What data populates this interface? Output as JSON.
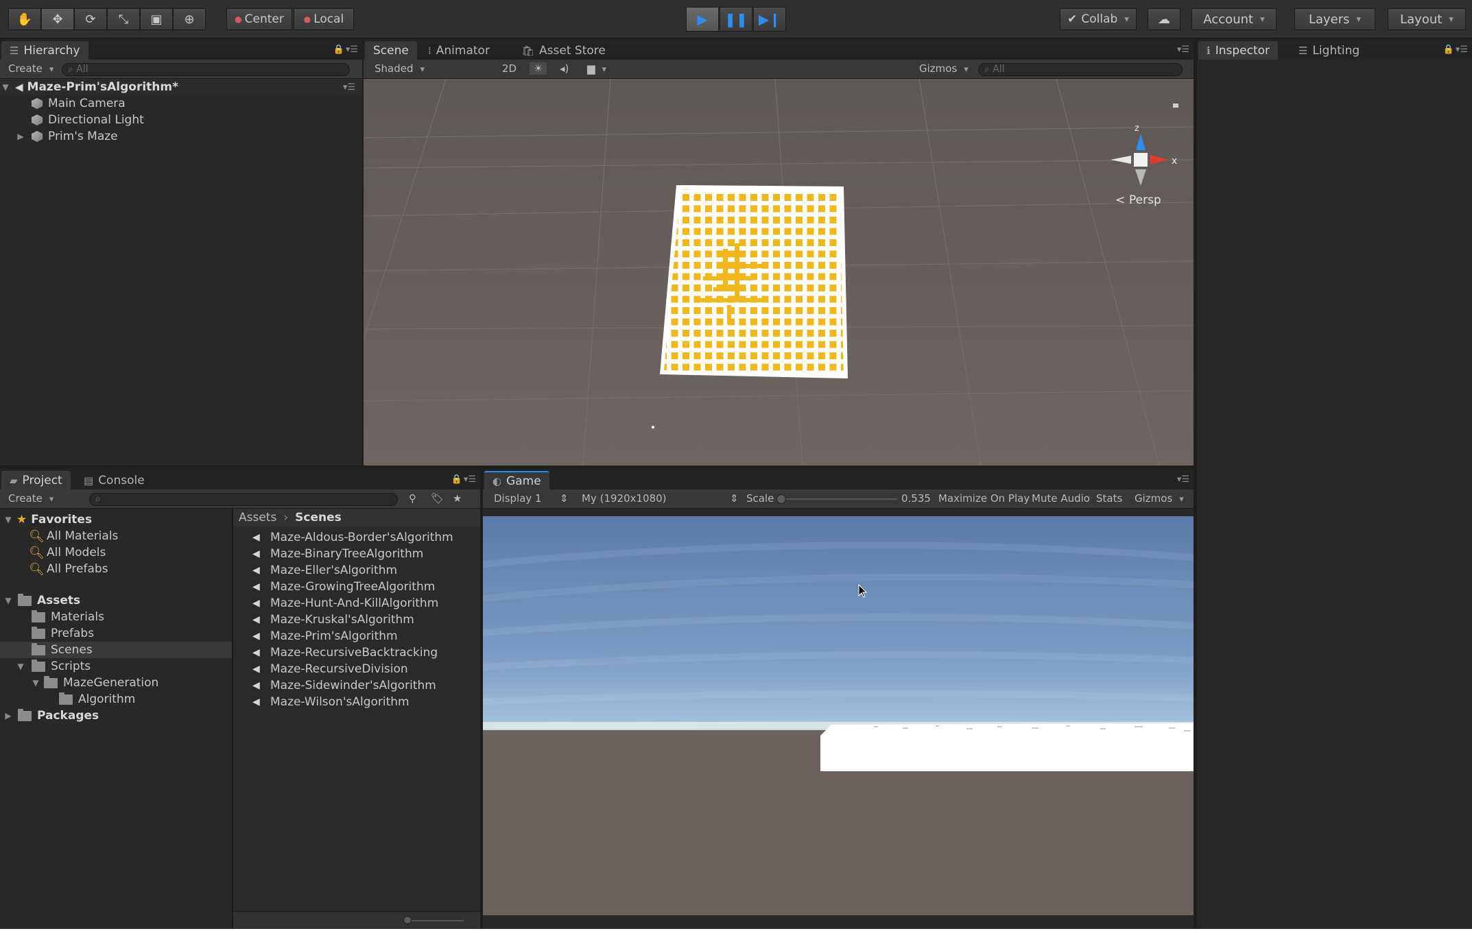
{
  "toolbar": {
    "tools": [
      {
        "icon": "hand-icon",
        "glyph": "✋"
      },
      {
        "icon": "move-icon",
        "glyph": "✥"
      },
      {
        "icon": "rotate-icon",
        "glyph": "⟳"
      },
      {
        "icon": "scale-icon",
        "glyph": "⤡"
      },
      {
        "icon": "rect-icon",
        "glyph": "▣"
      },
      {
        "icon": "transform-icon",
        "glyph": "⊕"
      }
    ],
    "pivot": "Center",
    "space": "Local",
    "collab": "Collab",
    "account": "Account",
    "layers": "Layers",
    "layout": "Layout",
    "accent": "#2f8cf0"
  },
  "hierarchy": {
    "tab": "Hierarchy",
    "create": "Create",
    "search_placeholder": "All",
    "scene_name": "Maze-Prim'sAlgorithm*",
    "items": [
      "Main Camera",
      "Directional Light",
      "Prim's Maze"
    ]
  },
  "scene": {
    "tabs": [
      "Scene",
      "Animator",
      "Asset Store"
    ],
    "shading": "Shaded",
    "mode_2d": "2D",
    "gizmos": "Gizmos",
    "search_placeholder": "All",
    "projection": "Persp",
    "axis_labels": {
      "z": "z",
      "x": "x"
    },
    "maze_color": "#f0b81c"
  },
  "inspector": {
    "tabs": [
      "Inspector",
      "Lighting"
    ]
  },
  "project": {
    "tabs": [
      "Project",
      "Console"
    ],
    "create": "Create",
    "favorites_label": "Favorites",
    "favorites": [
      "All Materials",
      "All Models",
      "All Prefabs"
    ],
    "assets_label": "Assets",
    "assets_tree": {
      "materials": "Materials",
      "prefabs": "Prefabs",
      "scenes": "Scenes",
      "scripts": "Scripts",
      "maze_generation": "MazeGeneration",
      "algorithm": "Algorithm"
    },
    "packages_label": "Packages",
    "breadcrumb": {
      "root": "Assets",
      "current": "Scenes"
    },
    "scenes": [
      "Maze-Aldous-Border'sAlgorithm",
      "Maze-BinaryTreeAlgorithm",
      "Maze-Eller'sAlgorithm",
      "Maze-GrowingTreeAlgorithm",
      "Maze-Hunt-And-KillAlgorithm",
      "Maze-Kruskal'sAlgorithm",
      "Maze-Prim'sAlgorithm",
      "Maze-RecursiveBacktracking",
      "Maze-RecursiveDivision",
      "Maze-Sidewinder'sAlgorithm",
      "Maze-Wilson'sAlgorithm"
    ]
  },
  "game": {
    "tab": "Game",
    "display": "Display 1",
    "resolution": "My (1920x1080)",
    "scale_label": "Scale",
    "scale_value": "0.535",
    "maximize": "Maximize On Play",
    "mute": "Mute Audio",
    "stats": "Stats",
    "gizmos": "Gizmos"
  }
}
